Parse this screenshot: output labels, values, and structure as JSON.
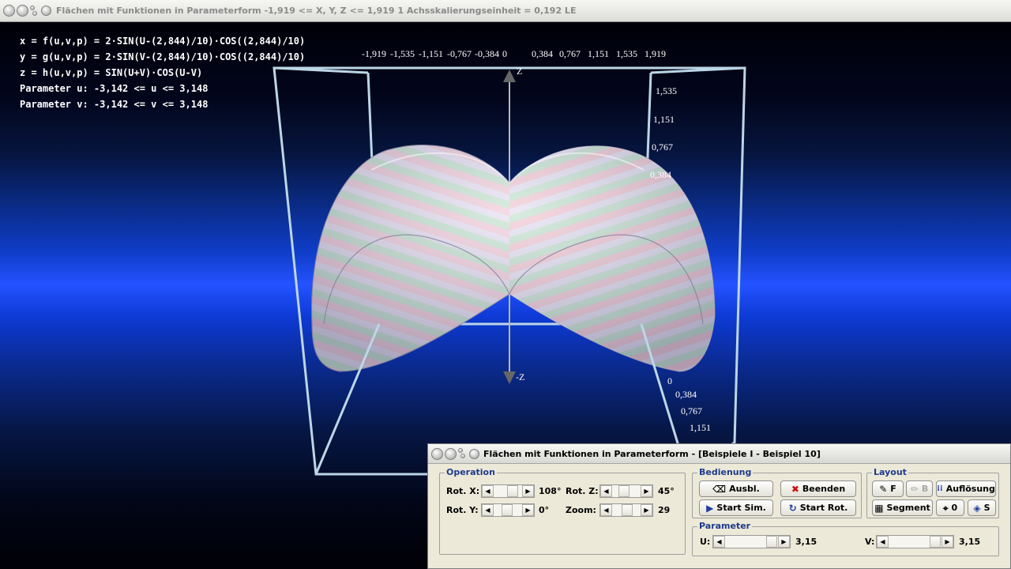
{
  "window": {
    "title": "Flächen mit Funktionen in Parameterform   -1,919 <= X, Y, Z <= 1,919    1 Achsskalierungseinheit = 0,192 LE"
  },
  "formulas": [
    "x = f(u,v,p) = 2·SIN(U-(2,844)/10)·COS((2,844)/10)",
    "y = g(u,v,p) = 2·SIN(V-(2,844)/10)·COS((2,844)/10)",
    "z = h(u,v,p) = SIN(U+V)·COS(U-V)",
    "Parameter u: -3,142 <= u <= 3,148",
    "Parameter v: -3,142 <= v <= 3,148"
  ],
  "axes": {
    "x_ticks": [
      "-1,919",
      "-1,535",
      "-1,151",
      "-0,767",
      "-0,384",
      "0",
      "0,384",
      "0,767",
      "1,151",
      "1,535",
      "1,919"
    ],
    "z_ticks": [
      "1,535",
      "1,151",
      "0,767",
      "0,384"
    ],
    "y_ticks": [
      "0",
      "0,384",
      "0,767",
      "1,151"
    ],
    "z_label": "Z",
    "neg_z_label": "-Z"
  },
  "dialog": {
    "title": "Flächen mit Funktionen in Parameterform - [Beispiele I - Beispiel 10]",
    "operation": {
      "label": "Operation",
      "rot_x_label": "Rot. X:",
      "rot_x_value": "108°",
      "rot_y_label": "Rot. Y:",
      "rot_y_value": "0°",
      "rot_z_label": "Rot. Z:",
      "rot_z_value": "45°",
      "zoom_label": "Zoom:",
      "zoom_value": "29"
    },
    "bedienung": {
      "label": "Bedienung",
      "ausbl": "Ausbl.",
      "beenden": "Beenden",
      "start_sim": "Start Sim.",
      "start_rot": "Start Rot."
    },
    "layout": {
      "label": "Layout",
      "f": "F",
      "b": "B",
      "aufloesung": "Auflösung",
      "segment": "Segment",
      "zero": "0",
      "s": "S"
    },
    "parameter": {
      "label": "Parameter",
      "u_label": "U:",
      "u_value": "3,15",
      "v_label": "V:",
      "v_value": "3,15"
    }
  },
  "icons": [
    "window-menu-icon",
    "eraser-icon",
    "brush-icon",
    "resolution-icon",
    "close-x-icon",
    "play-icon",
    "rotate-icon",
    "table-icon",
    "origin-icon",
    "fill-icon"
  ]
}
